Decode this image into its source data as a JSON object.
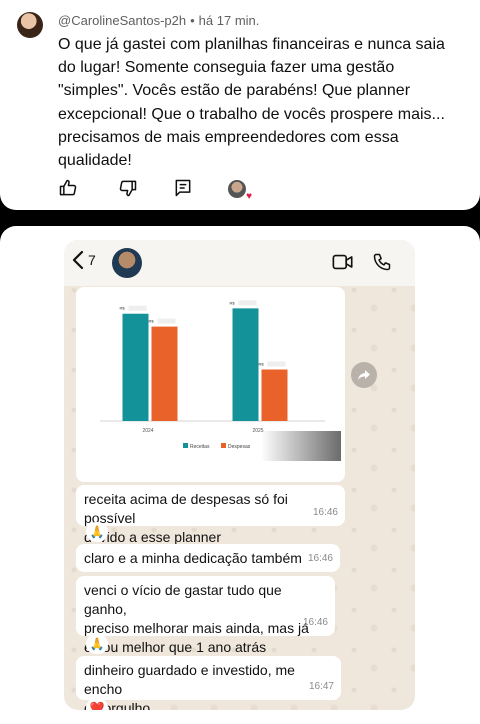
{
  "comment": {
    "author": "@CarolineSantos-p2h",
    "separator": "•",
    "time": "há 17 min.",
    "text": "O que já gastei com planilhas financeiras e nunca saia\ndo lugar! Somente conseguia fazer uma gestão\n\"simples\". Vocês estão de parabéns! Que planner\nexcepcional!  Que o trabalho de vocês prospere mais...\nprecisamos de mais empreendedores com essa\nqualidade!",
    "actions": [
      "thumbs-up-icon",
      "thumbs-down-icon",
      "reply-icon",
      "creator-heart-icon"
    ]
  },
  "whatsapp": {
    "back_count": "7",
    "messages": [
      {
        "text": "receita acima de despesas só foi possível\ndevido a esse planner",
        "time": "16:46",
        "reaction": "🙏"
      },
      {
        "text": "claro e a minha dedicação também",
        "time": "16:46"
      },
      {
        "text": "venci o vício de gastar tudo que ganho,\npreciso melhorar mais ainda, mas já\nestou melhor que 1 ano atrás",
        "time": "16:46",
        "reaction": "🙏"
      },
      {
        "text": "dinheiro guardado e investido, me encho\nde orgulho",
        "time": "16:47",
        "reaction": "❤️"
      }
    ]
  },
  "chart_data": {
    "type": "bar",
    "categories": [
      "2024",
      "2025"
    ],
    "series": [
      {
        "name": "Receitas",
        "values": [
          100,
          105
        ],
        "color": "#14929a"
      },
      {
        "name": "Despesas",
        "values": [
          88,
          48
        ],
        "color": "#e8622a"
      }
    ],
    "bar_labels": "R$",
    "ylim": [
      0,
      110
    ],
    "legend": "bottom",
    "grid": false
  }
}
